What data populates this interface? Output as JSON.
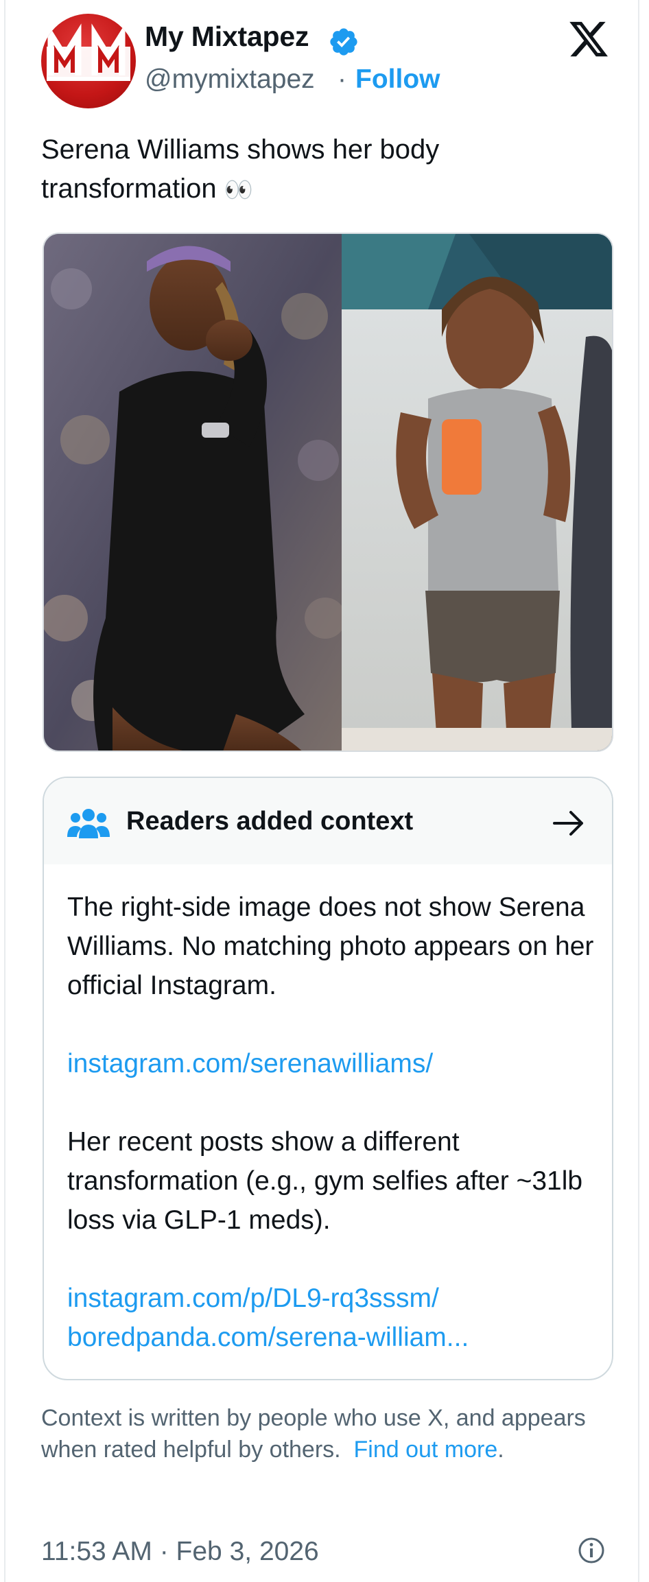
{
  "author": {
    "name": "My Mixtapez",
    "handle": "@mymixtapez",
    "separator": "·",
    "follow_label": "Follow",
    "avatar_text": "MM",
    "verified": true
  },
  "tweet": {
    "text": "Serena Williams shows her body transformation",
    "emoji": "👀",
    "images": [
      {
        "description_icon": "photo-left"
      },
      {
        "description_icon": "photo-right"
      }
    ]
  },
  "community_note": {
    "title": "Readers added context",
    "paragraph_1": "The right-side image does not show Serena Williams. No matching photo appears on her official Instagram.",
    "link_1": "instagram.com/serenawilliams/",
    "paragraph_2": "Her recent posts show a different transformation (e.g., gym selfies after ~31lb loss via GLP-1 meds).",
    "link_2": "instagram.com/p/DL9-rq3sssm/",
    "link_3": "boredpanda.com/serena-william..."
  },
  "footer": {
    "note": "Context is written by people who use X, and appears when rated helpful by others.",
    "find_out_more": "Find out more",
    "period": ".",
    "timestamp": "11:53 AM · Feb 3, 2026"
  },
  "colors": {
    "accent": "#1d9bf0",
    "secondary_text": "#536471",
    "brand_red": "#c41616"
  }
}
